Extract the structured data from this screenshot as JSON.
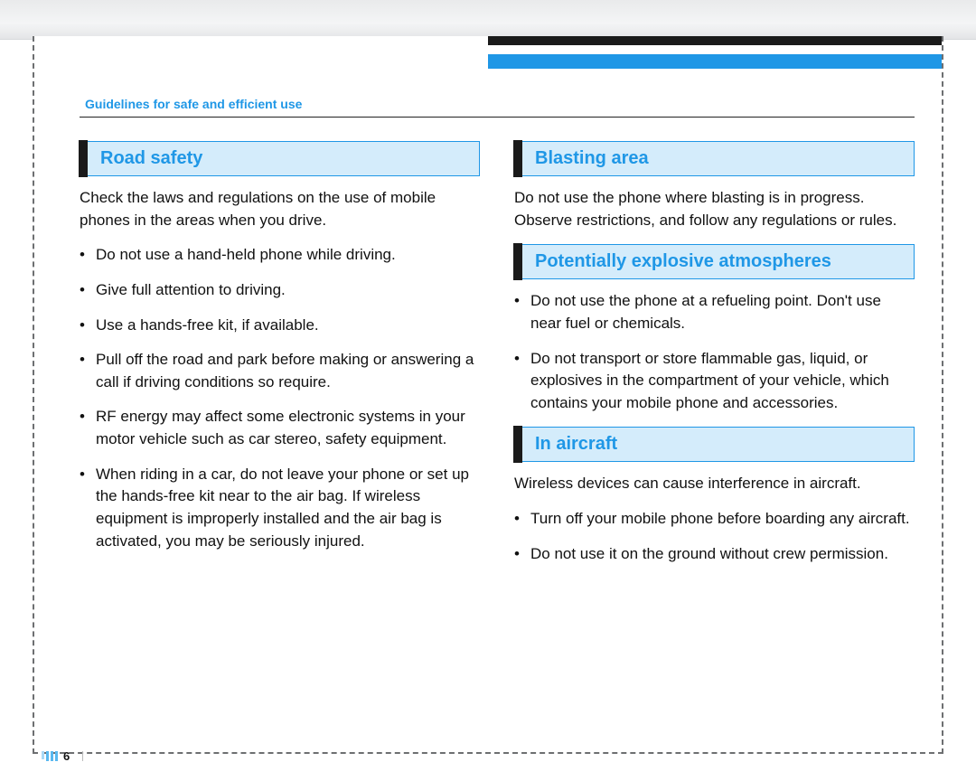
{
  "header": {
    "section_title": "Guidelines for safe and efficient use"
  },
  "left": {
    "heading": "Road safety",
    "intro": "Check the laws and regulations on the use of mobile phones in the areas when you drive.",
    "bullets": [
      "Do not use a hand-held phone while driving.",
      "Give full attention to driving.",
      "Use a hands-free kit, if available.",
      "Pull off the road and park before making or answering a call if driving conditions so require.",
      "RF energy may affect some electronic systems in your motor vehicle such as car stereo, safety equipment.",
      "When riding in a car, do not leave your phone or set up the hands-free kit near to the air bag. If wireless equipment is improperly installed and the air bag is activated, you may be seriously injured."
    ]
  },
  "right": {
    "blasting": {
      "heading": "Blasting area",
      "para": "Do not use the phone where blasting is in progress. Observe restrictions, and follow any regulations or rules."
    },
    "explosive": {
      "heading": "Potentially explosive atmospheres",
      "bullets": [
        "Do not use the phone at a refueling point. Don't use near fuel or chemicals.",
        "Do not transport or store flammable gas, liquid, or explosives in the compartment of your vehicle, which contains your mobile phone and accessories."
      ]
    },
    "aircraft": {
      "heading": "In aircraft",
      "intro": "Wireless devices can cause interference in aircraft.",
      "bullets": [
        "Turn off your mobile phone before boarding any aircraft.",
        "Do not use it on the ground without crew permission."
      ]
    }
  },
  "page_number": "6"
}
